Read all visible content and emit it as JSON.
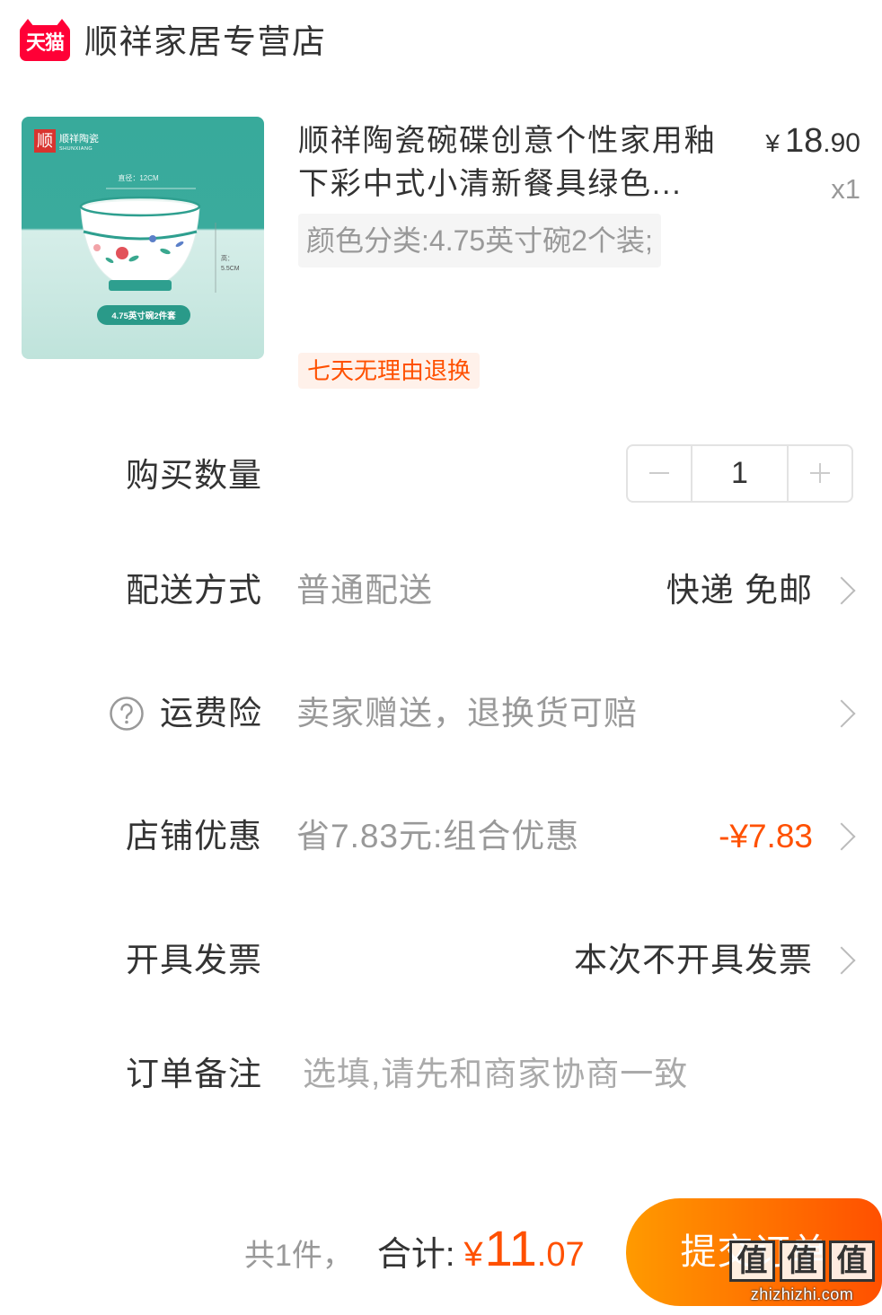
{
  "header": {
    "platform_logo_text": "天猫",
    "store_name": "顺祥家居专营店"
  },
  "product": {
    "title_lines": [
      "顺祥陶瓷碗碟创意个性家用釉",
      "下彩中式小清新餐具绿色..."
    ],
    "price": {
      "currency": "¥",
      "integer": "18",
      "decimal": ".90"
    },
    "quantity": "x1",
    "sku": "颜色分类:4.75英寸碗2个装;",
    "badge": "七天无理由退换",
    "image": {
      "brand_mark": "顺",
      "brand_name": "顺祥陶瓷",
      "brand_latin": "SHUNXIANG",
      "diameter_label": "直径：12CM",
      "height_label": "高：",
      "height_value": "5.5CM",
      "set_label": "4.75英寸碗2件套"
    }
  },
  "quantity_row": {
    "label": "购买数量",
    "value": "1"
  },
  "delivery_row": {
    "label": "配送方式",
    "value": "普通配送",
    "detail": "快递 免邮"
  },
  "insurance_row": {
    "label": "运费险",
    "value": "卖家赠送，退换货可赔"
  },
  "discount_row": {
    "label": "店铺优惠",
    "value": "省7.83元:组合优惠",
    "amount": "-¥7.83"
  },
  "invoice_row": {
    "label": "开具发票",
    "detail": "本次不开具发票"
  },
  "note_row": {
    "label": "订单备注",
    "placeholder": "选填,请先和商家协商一致",
    "value": ""
  },
  "footer": {
    "item_count": "共1件，",
    "total_label": "合计:",
    "total": {
      "currency": "¥",
      "integer": "11",
      "decimal": ".07"
    },
    "submit_label": "提交订单"
  },
  "watermark": {
    "logo_chars": [
      "值",
      "值",
      "值"
    ],
    "site": "zhizhizhi.com"
  },
  "icons": {
    "platform_logo": "tmall-logo",
    "chevron": "chevron-right-icon",
    "help": "question-circle-icon",
    "decrease": "minus-icon",
    "increase": "plus-icon"
  },
  "colors": {
    "accent": "#ff5000",
    "brand": "#ff0036",
    "text": "#333333",
    "muted": "#999999",
    "submit_gradient": [
      "#ff9a00",
      "#ff5000"
    ]
  }
}
